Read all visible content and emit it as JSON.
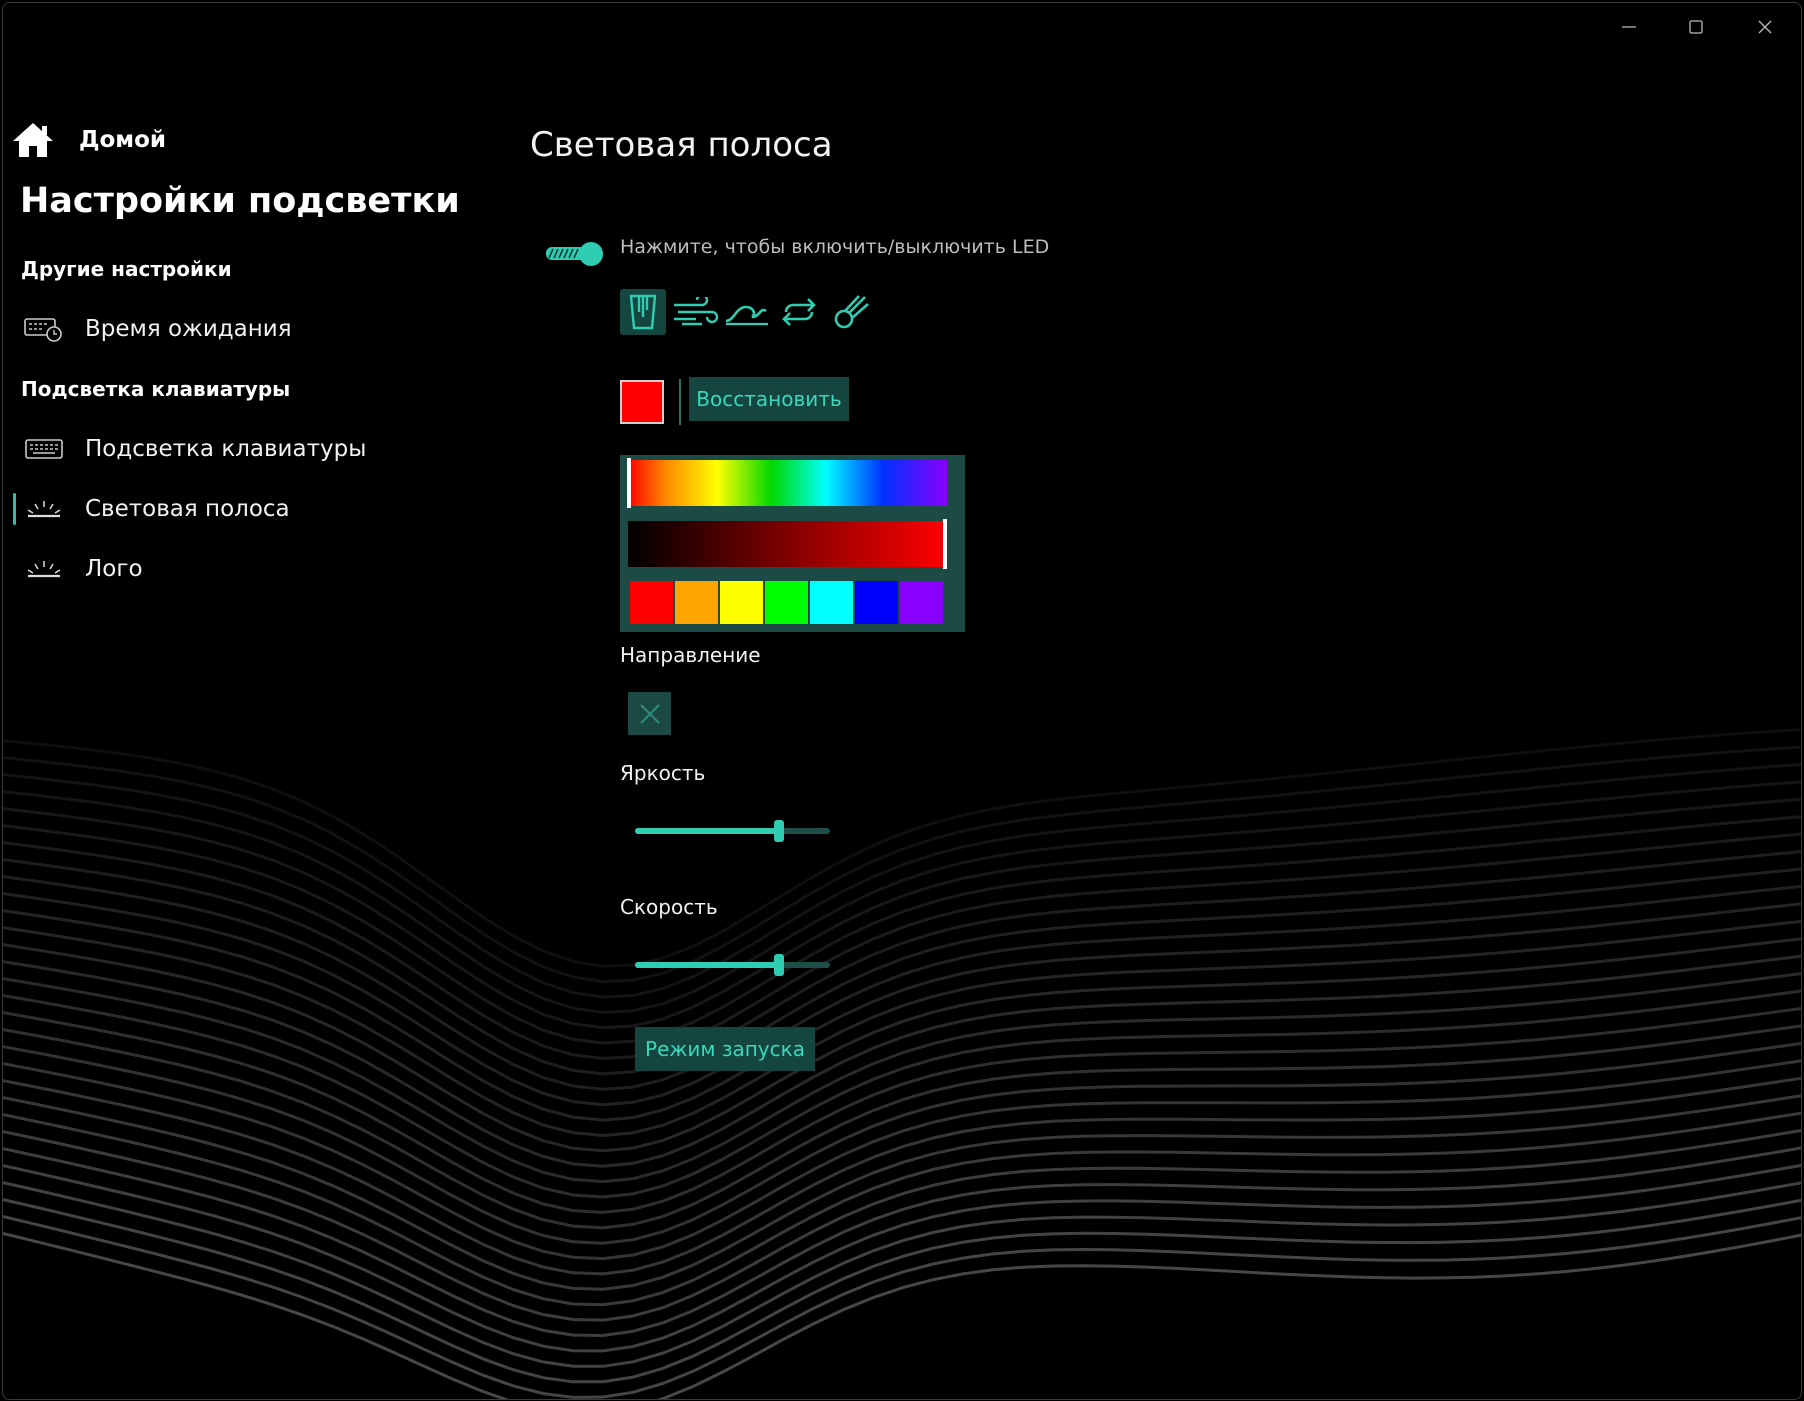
{
  "window": {
    "minimize_icon": "minimize-icon",
    "maximize_icon": "maximize-icon",
    "close_icon": "close-icon"
  },
  "sidebar": {
    "home_label": "Домой",
    "app_title": "Настройки подсветки",
    "sections": [
      {
        "header": "Другие настройки",
        "items": [
          {
            "label": "Время ожидания",
            "icon": "keyboard-timer-icon"
          }
        ]
      },
      {
        "header": "Подсветка клавиатуры",
        "items": [
          {
            "label": "Подсветка клавиатуры",
            "icon": "keyboard-icon"
          },
          {
            "label": "Световая полоса",
            "icon": "light-bar-icon",
            "selected": true
          },
          {
            "label": "Лого",
            "icon": "light-bar-icon"
          }
        ]
      }
    ]
  },
  "main": {
    "page_title": "Световая полоса",
    "led_toggle": {
      "label": "Нажмите, чтобы включить/выключить LED",
      "on": true
    },
    "effects": [
      {
        "icon": "static-light-icon",
        "selected": true
      },
      {
        "icon": "wind-icon",
        "selected": false
      },
      {
        "icon": "wave-icon",
        "selected": false
      },
      {
        "icon": "cycle-icon",
        "selected": false
      },
      {
        "icon": "comet-icon",
        "selected": false
      }
    ],
    "current_color": "#ff0000",
    "restore_button": "Восстановить",
    "palette": [
      "#ff0000",
      "#ffa500",
      "#ffff00",
      "#00ff00",
      "#00ffff",
      "#0000ff",
      "#8a00ff"
    ],
    "direction_label": "Направление",
    "direction_icon": "close-icon",
    "brightness_label": "Яркость",
    "brightness_value": 0.74,
    "speed_label": "Скорость",
    "speed_value": 0.74,
    "launch_mode_button": "Режим запуска",
    "accent_color": "#2fcdb2"
  }
}
